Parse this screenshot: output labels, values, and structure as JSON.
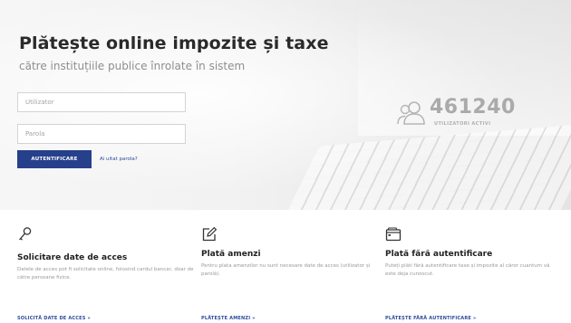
{
  "hero": {
    "title": "Plătește online impozite și taxe",
    "subtitle": "către instituțiile publice înrolate în sistem",
    "username_placeholder": "Utilizator",
    "password_placeholder": "Parola",
    "login_label": "AUTENTIFICARE",
    "forgot_label": "Ai uitat parola?",
    "users_count": "461240",
    "users_label": "UTILIZATORI ACTIVI",
    "users_icon": "users-icon"
  },
  "cards": [
    {
      "icon": "key-icon",
      "title": "Solicitare date de acces",
      "text": "Datele de acces pot fi solicitate online, folosind cardul bancar, doar de către persoane fizice.",
      "link": "SOLICITĂ DATE DE ACCES »"
    },
    {
      "icon": "edit-icon",
      "title": "Plată amenzi",
      "text": "Pentru plata amenzilor nu sunt necesare date de acces (utilizator și parolă).",
      "link": "PLĂTEȘTE AMENZI »"
    },
    {
      "icon": "wallet-icon",
      "title": "Plată fără autentificare",
      "text": "Puteți plăti fără autentificare taxe și impozite al căror cuantum vă este deja cunoscut.",
      "link": "PLĂTEȘTE FĂRĂ AUTENTIFICARE »"
    }
  ],
  "colors": {
    "primary": "#27408b",
    "link": "#2b4b9b",
    "title": "#2a2a2a",
    "muted": "#999999"
  }
}
